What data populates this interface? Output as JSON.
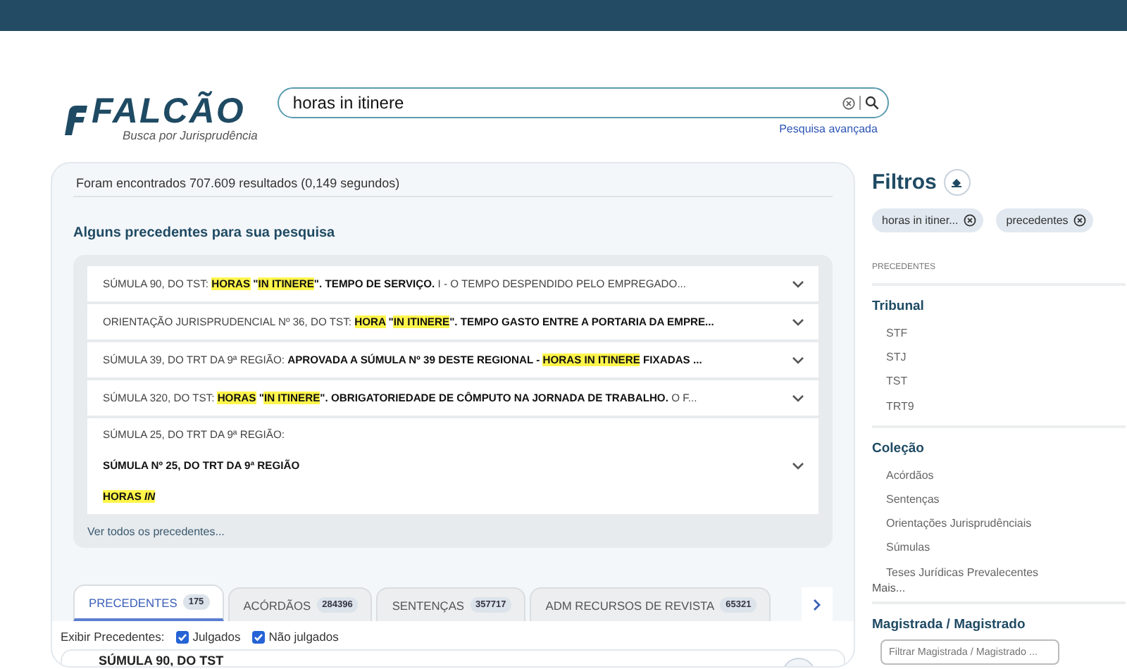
{
  "logo": {
    "name": "FALCÃO",
    "tagline": "Busca por Jurisprudência"
  },
  "search": {
    "value": "horas in itinere",
    "advanced_link": "Pesquisa avançada"
  },
  "results": {
    "summary": "Foram encontrados 707.609 resultados (0,149 segundos)",
    "precedents_heading": "Alguns precedentes para sua pesquisa",
    "precedents": [
      {
        "lines": [
          [
            {
              "kind": "plain",
              "text": "SÚMULA 90, DO TST: "
            },
            {
              "kind": "mark",
              "text": "HORAS"
            },
            {
              "kind": "bold",
              "text": " \""
            },
            {
              "kind": "mark",
              "text": "IN ITINERE"
            },
            {
              "kind": "bold",
              "text": "\". TEMPO DE SERVIÇO."
            },
            {
              "kind": "plain",
              "text": " I - O TEMPO DESPENDIDO PELO EMPREGADO..."
            }
          ]
        ]
      },
      {
        "lines": [
          [
            {
              "kind": "plain",
              "text": "ORIENTAÇÃO JURISPRUDENCIAL Nº 36, DO TST: "
            },
            {
              "kind": "mark",
              "text": "HORA"
            },
            {
              "kind": "bold",
              "text": " \""
            },
            {
              "kind": "mark",
              "text": "IN ITINERE"
            },
            {
              "kind": "bold",
              "text": "\". TEMPO GASTO ENTRE A PORTARIA DA EMPRE..."
            }
          ]
        ]
      },
      {
        "lines": [
          [
            {
              "kind": "plain",
              "text": "SÚMULA 39, DO TRT DA 9ª REGIÃO: "
            },
            {
              "kind": "bold",
              "text": "APROVADA A SÚMULA Nº 39 DESTE REGIONAL - "
            },
            {
              "kind": "mark",
              "text": "HORAS IN ITINERE"
            },
            {
              "kind": "bold",
              "text": " FIXADAS ..."
            }
          ]
        ]
      },
      {
        "lines": [
          [
            {
              "kind": "plain",
              "text": "SÚMULA 320, DO TST: "
            },
            {
              "kind": "mark",
              "text": "HORAS"
            },
            {
              "kind": "bold",
              "text": " \""
            },
            {
              "kind": "mark",
              "text": "IN ITINERE"
            },
            {
              "kind": "bold",
              "text": "\". OBRIGATORIEDADE DE CÔMPUTO NA JORNADA DE TRABALHO."
            },
            {
              "kind": "plain",
              "text": " O F..."
            }
          ]
        ]
      },
      {
        "lines": [
          [
            {
              "kind": "plain",
              "text": "SÚMULA 25, DO TRT DA 9ª REGIÃO:"
            }
          ],
          [
            {
              "kind": "bold",
              "text": "SÚMULA Nº 25, DO TRT DA 9ª REGIÃO"
            }
          ],
          [
            {
              "kind": "mark",
              "text": "HORAS "
            },
            {
              "kind": "mark-italic",
              "text": "IN"
            }
          ]
        ]
      }
    ],
    "see_all": "Ver todos os precedentes...",
    "tabs": [
      {
        "label": "PRECEDENTES",
        "count": "175",
        "selected": true
      },
      {
        "label": "ACÓRDÃOS",
        "count": "284396",
        "selected": false
      },
      {
        "label": "SENTENÇAS",
        "count": "357717",
        "selected": false
      },
      {
        "label": "ADM RECURSOS DE REVISTA",
        "count": "65321",
        "selected": false
      }
    ],
    "show_label": "Exibir Precedentes:",
    "show_options": [
      {
        "label": "Julgados",
        "checked": true
      },
      {
        "label": "Não julgados",
        "checked": true
      }
    ],
    "first_result_title": "SÚMULA 90, DO TST"
  },
  "filters": {
    "title": "Filtros",
    "chips": [
      "horas in itiner...",
      "precedentes"
    ],
    "section_label": "PRECEDENTES",
    "groups": [
      {
        "title": "Tribunal",
        "items": [
          "STF",
          "STJ",
          "TST",
          "TRT9"
        ]
      },
      {
        "title": "Coleção",
        "items": [
          "Acórdãos",
          "Sentenças",
          "Orientações Jurisprudênciais",
          "Súmulas",
          "Teses Jurídicas Prevalecentes"
        ],
        "more": "Mais..."
      }
    ],
    "magistrate": {
      "title": "Magistrada / Magistrado",
      "placeholder": "Filtrar Magistrada / Magistrado ..."
    }
  }
}
